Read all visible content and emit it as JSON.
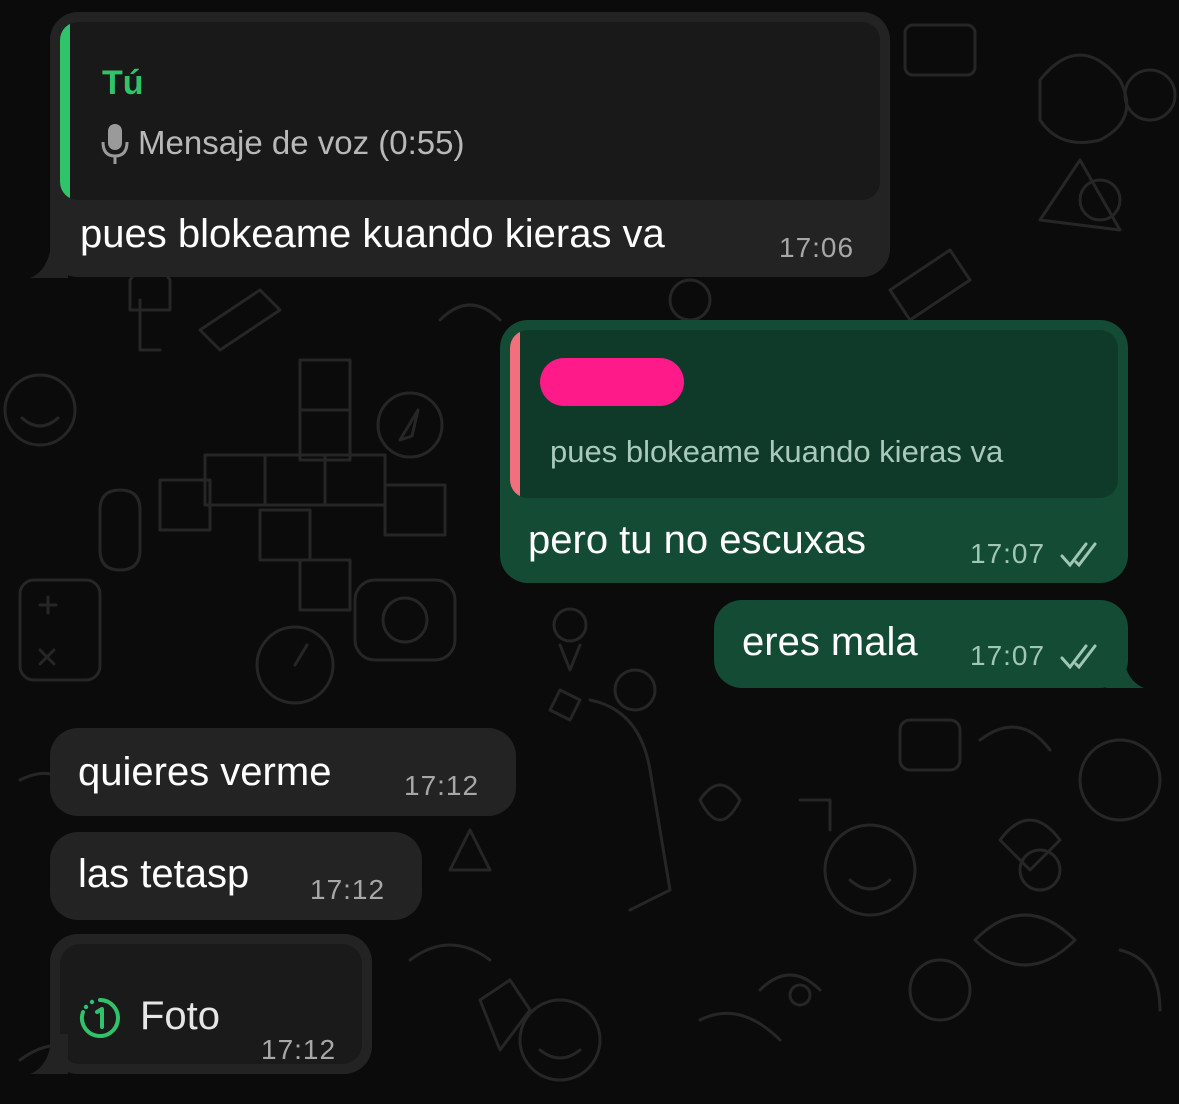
{
  "colors": {
    "wallpaper": "#0b0b0b",
    "incoming_bubble": "#232323",
    "outgoing_bubble": "#144b35",
    "quote_in_bg": "#191919",
    "quote_out_bg": "#0f3a29",
    "sender_green": "#2fc36a",
    "reply_bar_out": "#f1707c",
    "redaction_pink": "#ff1a8a",
    "timestamp_in": "#a7a7a7",
    "timestamp_out": "#9fc7b4"
  },
  "messages": [
    {
      "id": "m1",
      "direction": "incoming",
      "quote": {
        "sender": "Tú",
        "icon": "microphone-icon",
        "text": "Mensaje de voz (0:55)"
      },
      "text": "pues blokeame kuando kieras va",
      "time": "17:06"
    },
    {
      "id": "m2",
      "direction": "outgoing",
      "quote": {
        "sender_redacted": true,
        "text": "pues blokeame kuando kieras va"
      },
      "text": "pero tu no escuxas",
      "time": "17:07",
      "status_icon": "double-check-icon"
    },
    {
      "id": "m3",
      "direction": "outgoing",
      "text": "eres mala",
      "time": "17:07",
      "status_icon": "double-check-icon"
    },
    {
      "id": "m4",
      "direction": "incoming",
      "text": "quieres verme",
      "time": "17:12"
    },
    {
      "id": "m5",
      "direction": "incoming",
      "text": "las tetasp",
      "time": "17:12"
    },
    {
      "id": "m6",
      "direction": "incoming",
      "media": {
        "icon": "view-once-icon",
        "label": "Foto"
      },
      "time": "17:12"
    }
  ]
}
